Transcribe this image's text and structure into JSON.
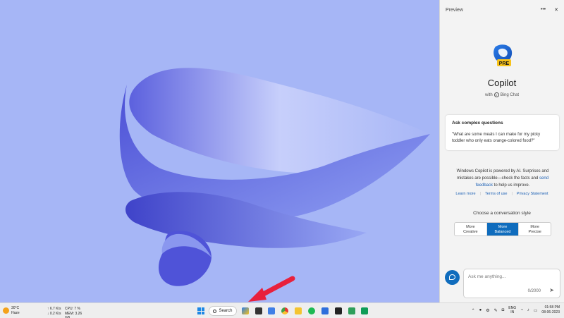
{
  "desktop": {
    "wallpaper": "windows-11-bloom",
    "accent": "#a6b6f6"
  },
  "copilot": {
    "header_title": "Preview",
    "more_icon": "more-icon",
    "close_icon": "close-icon",
    "logo_badge": "PRE",
    "name": "Copilot",
    "with_prefix": "with",
    "with_brand": "Bing Chat",
    "card": {
      "title": "Ask complex questions",
      "body": "\"What are some meals I can make for my picky toddler who only eats orange-colored food?\""
    },
    "disclaimer": {
      "part1": "Windows Copilot is powered by AI. Surprises and mistakes are possible—check the facts and ",
      "link": "send feedback",
      "part2": " to help us improve."
    },
    "links": [
      "Learn more",
      "Terms of use",
      "Privacy Statement"
    ],
    "style_title": "Choose a conversation style",
    "styles": [
      {
        "line1": "More",
        "line2": "Creative"
      },
      {
        "line1": "More",
        "line2": "Balanced"
      },
      {
        "line1": "More",
        "line2": "Precise"
      }
    ],
    "input_placeholder": "Ask me anything...",
    "char_count": "0/2000",
    "accent": "#0f6cbd"
  },
  "taskbar": {
    "weather_temp": "30°C",
    "weather_cond": "Haze",
    "net_up": "↑ 6.7 K/s",
    "net_down": "↓ 0.2 K/s",
    "cpu": "CPU: 7 %",
    "mem": "MEM: 3.26 GB",
    "search_label": "Search",
    "lang_line1": "ENG",
    "lang_line2": "IN",
    "time": "01:58 PM",
    "date": "08-06-2023"
  }
}
